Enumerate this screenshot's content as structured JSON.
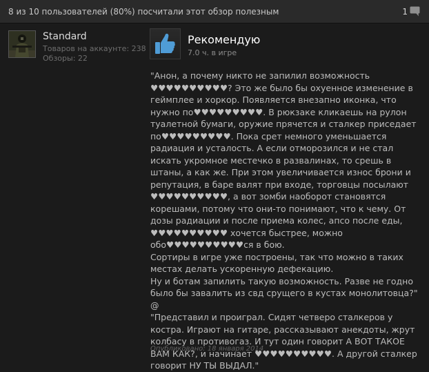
{
  "header": {
    "helpful_text": "8 из 10 пользователей (80%) посчитали этот обзор полезным",
    "comment_count": "1"
  },
  "author": {
    "name": "Standard",
    "games_owned": "Товаров на аккаунте: 238",
    "reviews": "Обзоры: 22"
  },
  "review": {
    "verdict": "Рекомендую",
    "hours": "7.0 ч. в игре",
    "text": "\"Анон, а почему никто не запилил возможность ♥♥♥♥♥♥♥♥♥♥? Это же было бы охуенное изменение в геймплее и хоркор. Появляется внезапно иконка, что нужно по♥♥♥♥♥♥♥♥♥. В рюкзаке кликаешь на рулон туалетной бумаги, оружие прячется и сталкер приседает по♥♥♥♥♥♥♥♥♥. Пока срет немного уменьшается радиация и усталость. А если отморозился и не стал искать укромное местечко в развалинах, то срешь в штаны, а как же. При этом увеличивается износ брони и репутация, в баре валят при входе, торговцы посылают ♥♥♥♥♥♥♥♥♥♥, а вот зомби наоборот становятся корешами, потому что они-то понимают, что к чему. От дозы радиации и после приема колес, апсо после еды, ♥♥♥♥♥♥♥♥♥♥ хочется быстрее, можно обо♥♥♥♥♥♥♥♥♥♥ся в бою.\nСортиры в игре уже построены, так что можно в таких местах делать ускоренную дефекацию.\nНу и ботам запилить такую возможность. Разве не годно было бы завалить из свд срущего в кустах монолитовца?\"\n@\n\"Представил и проиграл. Сидят четверо сталкеров у костра. Играют на гитаре, рассказывают анекдоты, жрут колбасу в противогаз. И тут один говорит А ВОТ ТАКОЕ ВАМ КАК?, и начинает ♥♥♥♥♥♥♥♥♥♥. А другой сталкер говорит НУ ТЫ ВЫДАЛ.\"",
    "posted": "Опубликовано: 18 января 2014"
  },
  "colors": {
    "background": "#1b1b1b",
    "thumb_icon": "#4f9cd6",
    "text": "#bcbcbc"
  },
  "icons": {
    "comment": "speech-bubble-icon",
    "vote": "thumbs-up-icon"
  }
}
